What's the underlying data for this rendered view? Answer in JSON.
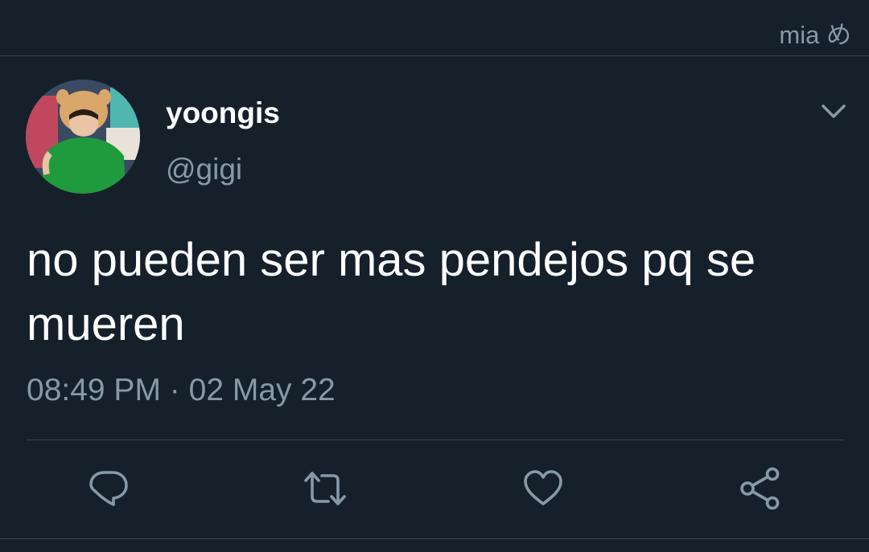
{
  "watermark": "mia め",
  "tweet": {
    "display_name": "yoongis",
    "handle": "@gigi",
    "text": "no pueden ser mas pendejos pq se mueren",
    "time": "08:49 PM",
    "separator": "·",
    "date": "02 May 22"
  },
  "icons": {
    "menu": "chevron-down-icon",
    "reply": "reply-icon",
    "retweet": "retweet-icon",
    "like": "heart-icon",
    "share": "share-icon"
  },
  "colors": {
    "background": "#15202b",
    "text": "#ffffff",
    "secondary_text": "#8899a6",
    "border": "#38444d"
  }
}
